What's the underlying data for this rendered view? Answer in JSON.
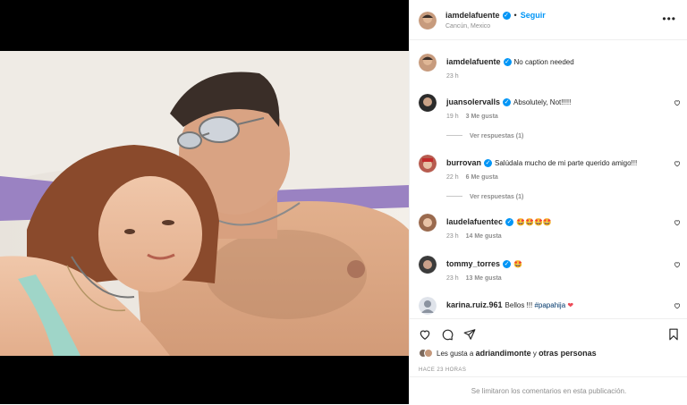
{
  "post": {
    "username": "iamdelafuente",
    "follow_label": "Seguir",
    "location": "Cancún, Mexico",
    "more_label": "•••"
  },
  "caption": {
    "username": "iamdelafuente",
    "text": "No caption needed",
    "time": "23 h"
  },
  "comments": [
    {
      "username": "juansolervalls",
      "verified": true,
      "text": "Absolutely, Not!!!!!",
      "time": "19 h",
      "likes": "3 Me gusta",
      "replies": "Ver respuestas (1)"
    },
    {
      "username": "burrovan",
      "verified": true,
      "text": "Salúdala mucho de mi parte querido amigo!!!",
      "time": "22 h",
      "likes": "6 Me gusta",
      "replies": "Ver respuestas (1)"
    },
    {
      "username": "laudelafuentec",
      "verified": true,
      "text": "🤩🤩🤩🤩",
      "time": "23 h",
      "likes": "14 Me gusta",
      "replies": ""
    },
    {
      "username": "tommy_torres",
      "verified": true,
      "text": "🤩",
      "time": "23 h",
      "likes": "13 Me gusta",
      "replies": ""
    },
    {
      "username": "karina.ruiz.961",
      "verified": false,
      "text": "Bellos !!! ",
      "hashtag": "#papahija",
      "heart": "❤",
      "time": "",
      "likes": "",
      "replies": ""
    }
  ],
  "likes": {
    "prefix": "Les gusta a ",
    "user": "adriandimonte",
    "middle": " y ",
    "others": "otras personas"
  },
  "time_ago": "HACE 23 HORAS",
  "comments_disabled": "Se limitaron los comentarios en esta publicación.",
  "colors": {
    "accent": "#0095f6",
    "muted": "#8e8e8e",
    "text": "#262626"
  }
}
